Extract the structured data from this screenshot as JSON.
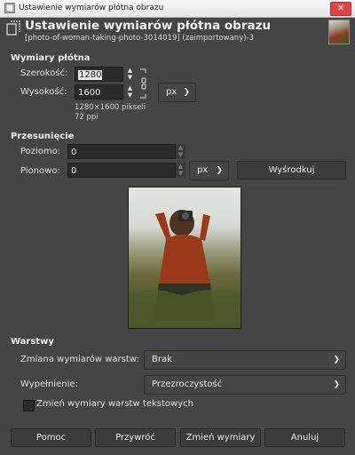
{
  "window": {
    "title": "Ustawienie wymiarów płótna obrazu",
    "close_symbol": "✕"
  },
  "header": {
    "title": "Ustawienie wymiarów płótna obrazu",
    "subtitle": "[photo-of-woman-taking-photo-3014019] (zaimportowany)-3"
  },
  "canvas_size": {
    "section": "Wymiary płótna",
    "width_label": "Szerokość:",
    "width_value": "1280",
    "height_label": "Wysokość:",
    "height_value": "1600",
    "unit": "px",
    "info_size": "1280×1600 pikseli",
    "info_ppi": "72 ppi"
  },
  "offset": {
    "section": "Przesunięcie",
    "x_label": "Poziomo:",
    "x_value": "0",
    "y_label": "Pionowo:",
    "y_value": "0",
    "unit": "px",
    "center_button": "Wyśrodkuj"
  },
  "layers": {
    "section": "Warstwy",
    "resize_label": "Zmiana wymiarów warstw:",
    "resize_value": "Brak",
    "fill_label": "Wypełnienie:",
    "fill_value": "Przezroczystość",
    "text_layers_checkbox": "Zmień wymiary warstw tekstowych",
    "text_layers_checked": false
  },
  "buttons": {
    "help": "Pomoc",
    "reset": "Przywróć",
    "resize": "Zmień wymiary",
    "cancel": "Anuluj"
  },
  "colors": {
    "background": "#454545",
    "entry": "#2b2b2b",
    "button": "#3c3c3c"
  }
}
